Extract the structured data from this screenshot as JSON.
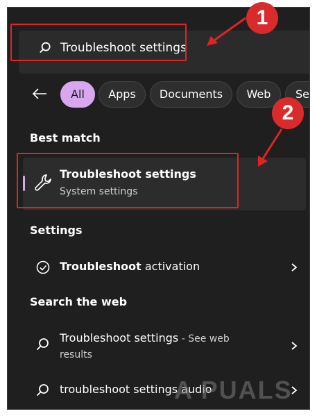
{
  "search": {
    "query": "Troubleshoot settings"
  },
  "badges": {
    "one": "1",
    "two": "2"
  },
  "filters": [
    {
      "label": "All",
      "active": true
    },
    {
      "label": "Apps"
    },
    {
      "label": "Documents"
    },
    {
      "label": "Web"
    },
    {
      "label": "Set"
    }
  ],
  "best_match": {
    "heading": "Best match",
    "title": "Troubleshoot settings",
    "subtitle": "System settings"
  },
  "settings_section": {
    "heading": "Settings",
    "item_bold": "Troubleshoot",
    "item_rest": " activation"
  },
  "web_section": {
    "heading": "Search the web",
    "item1_main": "Troubleshoot settings",
    "item1_suffix": " - See web",
    "item1_line2": "results",
    "item2": "troubleshoot settings audio"
  },
  "watermark": "A  PUALS",
  "colors": {
    "accent": "#d9a7f0",
    "callout": "#e02424",
    "panel": "#1f1f1f"
  }
}
